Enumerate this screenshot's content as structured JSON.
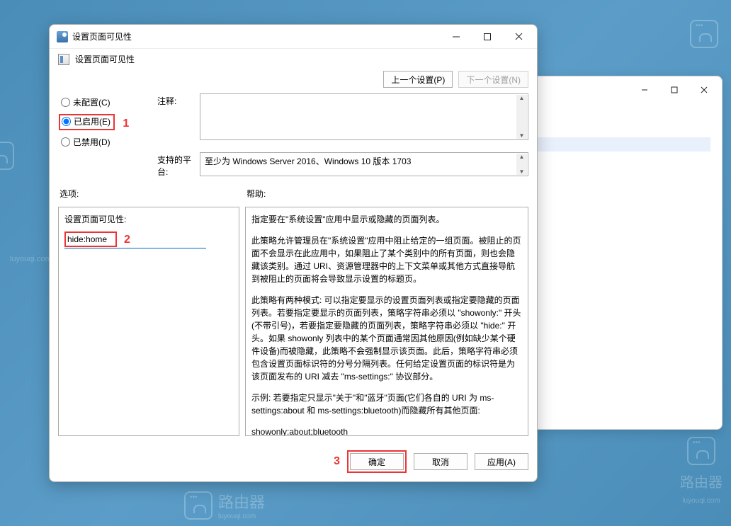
{
  "window": {
    "title": "设置页面可见性",
    "subtitle": "设置页面可见性"
  },
  "nav": {
    "prev": "上一个设置(P)",
    "next": "下一个设置(N)"
  },
  "radios": {
    "not_configured": "未配置(C)",
    "enabled": "已启用(E)",
    "disabled": "已禁用(D)"
  },
  "annotations": {
    "one": "1",
    "two": "2",
    "three": "3"
  },
  "labels": {
    "comments": "注释:",
    "platform": "支持的平台:",
    "options": "选项:",
    "help": "帮助:",
    "visibility_field": "设置页面可见性:"
  },
  "values": {
    "platform_text": "至少为 Windows Server 2016、Windows 10 版本 1703",
    "visibility_input": "hide:home"
  },
  "help_paragraphs": [
    "指定要在\"系统设置\"应用中显示或隐藏的页面列表。",
    "此策略允许管理员在\"系统设置\"应用中阻止给定的一组页面。被阻止的页面不会显示在此应用中，如果阻止了某个类别中的所有页面，则也会隐藏该类别。通过 URI、资源管理器中的上下文菜单或其他方式直接导航到被阻止的页面将会导致显示设置的标题页。",
    "此策略有两种模式: 可以指定要显示的设置页面列表或指定要隐藏的页面列表。若要指定要显示的页面列表，策略字符串必须以 \"showonly:\" 开头(不带引号)，若要指定要隐藏的页面列表，策略字符串必须以 \"hide:\" 开头。如果 showonly 列表中的某个页面通常因其他原因(例如缺少某个硬件设备)而被隐藏，此策略不会强制显示该页面。此后，策略字符串必须包含设置页面标识符的分号分隔列表。任何给定设置页面的标识符是为该页面发布的 URI 减去 \"ms-settings:\" 协议部分。",
    "示例: 若要指定只显示\"关于\"和\"蓝牙\"页面(它们各自的 URI 为 ms-settings:about 和 ms-settings:bluetooth)而隐藏所有其他页面:",
    "showonly:about;bluetooth"
  ],
  "buttons": {
    "ok": "确定",
    "cancel": "取消",
    "apply": "应用(A)"
  },
  "watermark": {
    "brand": "路由器",
    "url": "luyouqi.com"
  }
}
